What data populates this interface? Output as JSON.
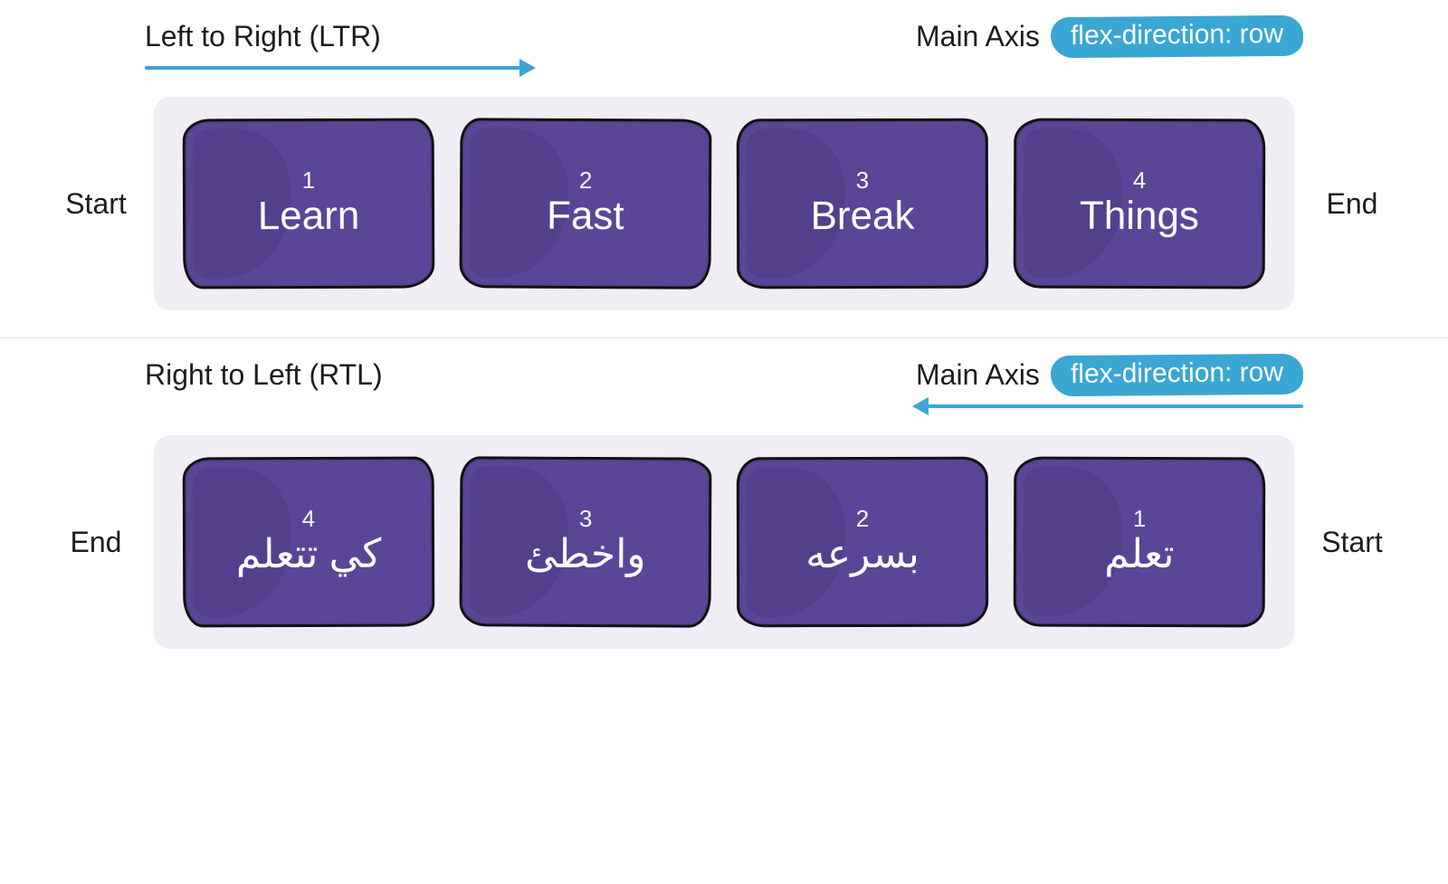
{
  "ltr": {
    "title": "Left to Right (LTR)",
    "axis_label": "Main Axis",
    "pill": "flex-direction: row",
    "start": "Start",
    "end": "End",
    "items": [
      {
        "num": "1",
        "word": "Learn"
      },
      {
        "num": "2",
        "word": "Fast"
      },
      {
        "num": "3",
        "word": "Break"
      },
      {
        "num": "4",
        "word": "Things"
      }
    ]
  },
  "rtl": {
    "title": "Right to Left (RTL)",
    "axis_label": "Main Axis",
    "pill": "flex-direction: row",
    "start": "Start",
    "end": "End",
    "items": [
      {
        "num": "4",
        "word": "كي تتعلم"
      },
      {
        "num": "3",
        "word": "واخطئ"
      },
      {
        "num": "2",
        "word": "بسرعه"
      },
      {
        "num": "1",
        "word": "تعلم"
      }
    ]
  }
}
